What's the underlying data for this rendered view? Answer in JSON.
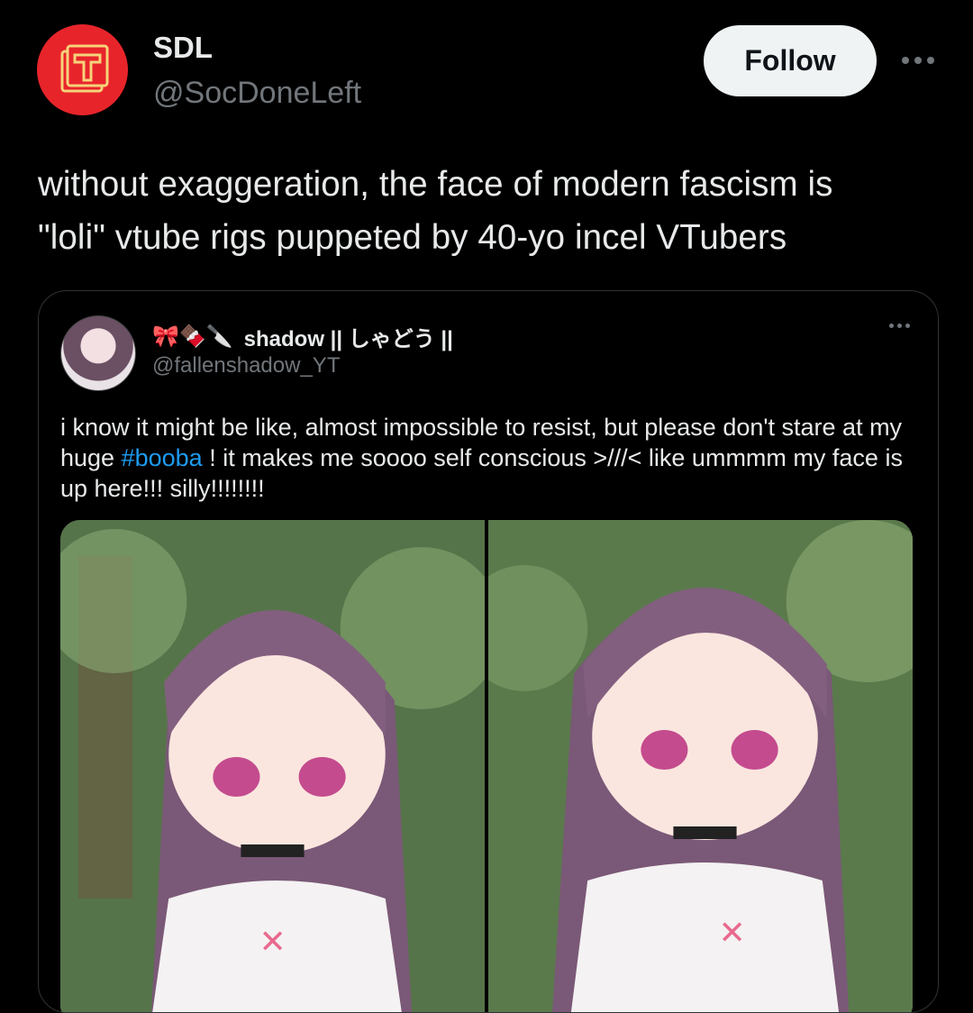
{
  "author": {
    "name": "SDL",
    "handle": "@SocDoneLeft",
    "avatar_icon": "book-t-logo-icon",
    "avatar_color": "#e8242b"
  },
  "actions": {
    "follow_label": "Follow",
    "more_icon": "more-horizontal-icon"
  },
  "tweet": {
    "line1": "without exaggeration, the face of modern fascism is",
    "line2": "\"loli\" vtube rigs puppeted by 40-yo incel VTubers"
  },
  "quote": {
    "emojis": "🎀🍫🔪",
    "name": "shadow || しゃどう ||",
    "handle": "@fallenshadow_YT",
    "text_before": "i know it might be like, almost impossible to resist, but please don't stare at my huge ",
    "hashtag": "#booba",
    "text_after": " ! it makes me soooo self conscious >///< like ummmm my face is up here!!! silly!!!!!!!!",
    "hashtag_color": "#1d9bf0",
    "media_description": "two anime vtuber avatar images"
  }
}
